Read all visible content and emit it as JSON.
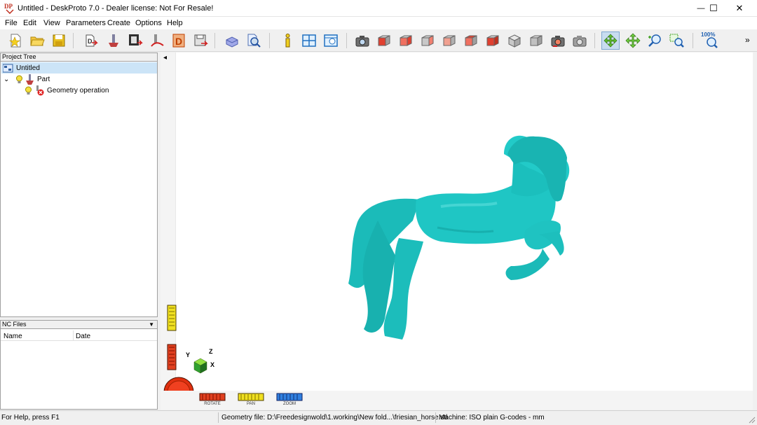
{
  "window": {
    "title": "Untitled - DeskProto 7.0 - Dealer license: Not For Resale!",
    "controls": {
      "minimize": "—",
      "maximize": "☐",
      "close": "✕"
    }
  },
  "menu": [
    "File",
    "Edit",
    "View",
    "Parameters",
    "Create",
    "Options",
    "Help"
  ],
  "toolbar": {
    "zoom_label": "100%",
    "more": "»"
  },
  "project_tree": {
    "header": "Project Tree",
    "collapse_arrow": "◂",
    "items": [
      {
        "label": "Untitled",
        "selected": true
      },
      {
        "label": "Part",
        "expander": "⌄"
      },
      {
        "label": "Geometry operation"
      }
    ]
  },
  "nc_files": {
    "header": "NC Files",
    "dropdown_arrow": "▼",
    "columns": [
      "Name",
      "Date"
    ]
  },
  "view_controls": {
    "rotate": "ROTATE",
    "pan": "PAN",
    "zoom": "ZOOM"
  },
  "axes": {
    "x": "X",
    "y": "Y",
    "z": "Z"
  },
  "status": {
    "help": "For Help, press F1",
    "geometry_file": "Geometry file: D:\\Freedesignwold\\1.working\\New fold...\\friesian_horse.stl",
    "machine": "Machine: ISO plain G-codes - mm"
  },
  "colors": {
    "model": "#1fc6c4",
    "accent": "#7ea6d0"
  }
}
